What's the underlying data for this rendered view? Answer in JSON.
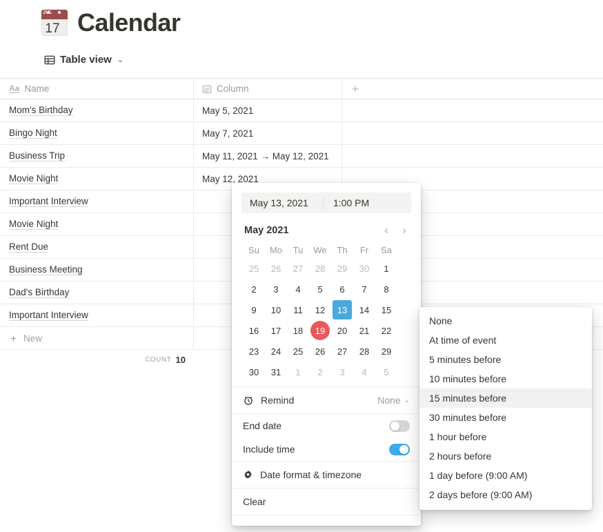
{
  "page": {
    "emoji": {
      "name": "calendar-emoji",
      "month": "JUL",
      "day": "17"
    },
    "title": "Calendar"
  },
  "viewbar": {
    "icon": "table-icon",
    "label": "Table view",
    "chevron": "⌄"
  },
  "table": {
    "columns": [
      {
        "icon": "text-type-icon",
        "glyph": "Aa",
        "label": "Name"
      },
      {
        "icon": "date-type-icon",
        "label": "Column"
      },
      {
        "icon": "plus-icon",
        "label": "+"
      }
    ],
    "rows": [
      {
        "name": "Mom's Birthday",
        "date": "May 5, 2021"
      },
      {
        "name": "Bingo Night",
        "date": "May 7, 2021"
      },
      {
        "name": "Business Trip",
        "date": "May 11, 2021 → May 12, 2021"
      },
      {
        "name": "Movie Night",
        "date": "May 12, 2021"
      },
      {
        "name": "Important Interview",
        "date": ""
      },
      {
        "name": "Movie Night",
        "date": ""
      },
      {
        "name": "Rent Due",
        "date": ""
      },
      {
        "name": "Business Meeting",
        "date": ""
      },
      {
        "name": "Dad's Birthday",
        "date": ""
      },
      {
        "name": "Important Interview",
        "date": ""
      }
    ],
    "new_row_label": "New",
    "count_label": "COUNT",
    "count_value": "10"
  },
  "date_picker": {
    "date_value": "May 13, 2021",
    "time_value": "1:00 PM",
    "month_label": "May 2021",
    "prev_label": "‹",
    "next_label": "›",
    "weekdays": [
      "Su",
      "Mo",
      "Tu",
      "We",
      "Th",
      "Fr",
      "Sa"
    ],
    "weeks": [
      [
        {
          "d": "25",
          "out": true
        },
        {
          "d": "26",
          "out": true
        },
        {
          "d": "27",
          "out": true
        },
        {
          "d": "28",
          "out": true
        },
        {
          "d": "29",
          "out": true
        },
        {
          "d": "30",
          "out": true
        },
        {
          "d": "1"
        }
      ],
      [
        {
          "d": "2"
        },
        {
          "d": "3"
        },
        {
          "d": "4"
        },
        {
          "d": "5"
        },
        {
          "d": "6"
        },
        {
          "d": "7"
        },
        {
          "d": "8"
        }
      ],
      [
        {
          "d": "9"
        },
        {
          "d": "10"
        },
        {
          "d": "11"
        },
        {
          "d": "12"
        },
        {
          "d": "13",
          "selected": true
        },
        {
          "d": "14"
        },
        {
          "d": "15"
        }
      ],
      [
        {
          "d": "16"
        },
        {
          "d": "17"
        },
        {
          "d": "18"
        },
        {
          "d": "19",
          "today": true
        },
        {
          "d": "20"
        },
        {
          "d": "21"
        },
        {
          "d": "22"
        }
      ],
      [
        {
          "d": "23"
        },
        {
          "d": "24"
        },
        {
          "d": "25"
        },
        {
          "d": "26"
        },
        {
          "d": "27"
        },
        {
          "d": "28"
        },
        {
          "d": "29"
        }
      ],
      [
        {
          "d": "30"
        },
        {
          "d": "31"
        },
        {
          "d": "1",
          "out": true
        },
        {
          "d": "2",
          "out": true
        },
        {
          "d": "3",
          "out": true
        },
        {
          "d": "4",
          "out": true
        },
        {
          "d": "5",
          "out": true
        }
      ]
    ],
    "remind": {
      "icon": "alarm-clock-icon",
      "label": "Remind",
      "value": "None",
      "chevron": "⌄"
    },
    "end_date": {
      "label": "End date",
      "on": false
    },
    "include_time": {
      "label": "Include time",
      "on": true
    },
    "date_format": {
      "icon": "gear-icon",
      "label": "Date format & timezone"
    },
    "clear": {
      "label": "Clear"
    }
  },
  "remind_menu": {
    "items": [
      {
        "label": "None"
      },
      {
        "label": "At time of event"
      },
      {
        "label": "5 minutes before"
      },
      {
        "label": "10 minutes before"
      },
      {
        "label": "15 minutes before",
        "highlighted": true
      },
      {
        "label": "30 minutes before"
      },
      {
        "label": "1 hour before"
      },
      {
        "label": "2 hours before"
      },
      {
        "label": "1 day before (9:00 AM)"
      },
      {
        "label": "2 days before (9:00 AM)"
      }
    ]
  },
  "colors": {
    "selected_day": "#4aa8db",
    "today": "#e8585c",
    "toggle_on": "#3eaaeb",
    "text": "#37352f",
    "muted": "#9b9a97"
  }
}
